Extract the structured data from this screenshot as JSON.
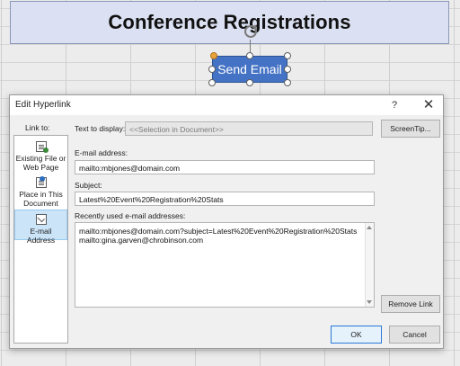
{
  "sheet": {
    "title": "Conference Registrations",
    "shape_label": "Send Email"
  },
  "dialog": {
    "title": "Edit Hyperlink",
    "help_label": "?",
    "close_label": "✕",
    "link_to_label": "Link to:",
    "text_to_display_label": "Text to display:",
    "text_to_display_value": "<<Selection in Document>>",
    "screentip_label": "ScreenTip...",
    "link_types": [
      {
        "line1": "Existing File or",
        "line2": "Web Page"
      },
      {
        "line1": "Place in This",
        "line2": "Document"
      },
      {
        "line1": "E-mail Address",
        "line2": ""
      }
    ],
    "email_label": "E-mail address:",
    "email_value": "mailto:mbjones@domain.com",
    "subject_label": "Subject:",
    "subject_value": "Latest%20Event%20Registration%20Stats",
    "recent_label": "Recently used e-mail addresses:",
    "recent_addresses": [
      "mailto:mbjones@domain.com?subject=Latest%20Event%20Registration%20Stats",
      "mailto:gina.garven@chrobinson.com"
    ],
    "remove_link_label": "Remove Link",
    "ok_label": "OK",
    "cancel_label": "Cancel"
  }
}
